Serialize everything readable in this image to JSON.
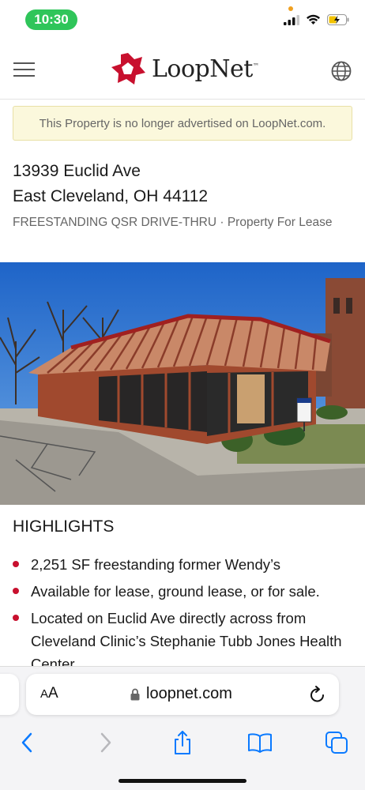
{
  "status_bar": {
    "time": "10:30"
  },
  "header": {
    "logo_text": "LoopNet",
    "logo_tm": "™",
    "brand_color": "#c8102e"
  },
  "notice": {
    "text": "This Property is no longer advertised on LoopNet.com."
  },
  "property": {
    "address_line1": "13939 Euclid Ave",
    "address_line2": "East Cleveland, OH 44112",
    "type_line": "FREESTANDING QSR DRIVE-THRU · Property For Lease"
  },
  "highlights": {
    "title": "HIGHLIGHTS",
    "items": [
      "2,251 SF freestanding former Wendy’s",
      "Available for lease, ground lease, or for sale.",
      "Located on Euclid Ave directly across from Cleveland Clinic’s Stephanie Tubb Jones Health Center"
    ]
  },
  "browser": {
    "aa_label_small": "A",
    "aa_label_large": "A",
    "url": "loopnet.com",
    "accent_color": "#0a7aff"
  }
}
